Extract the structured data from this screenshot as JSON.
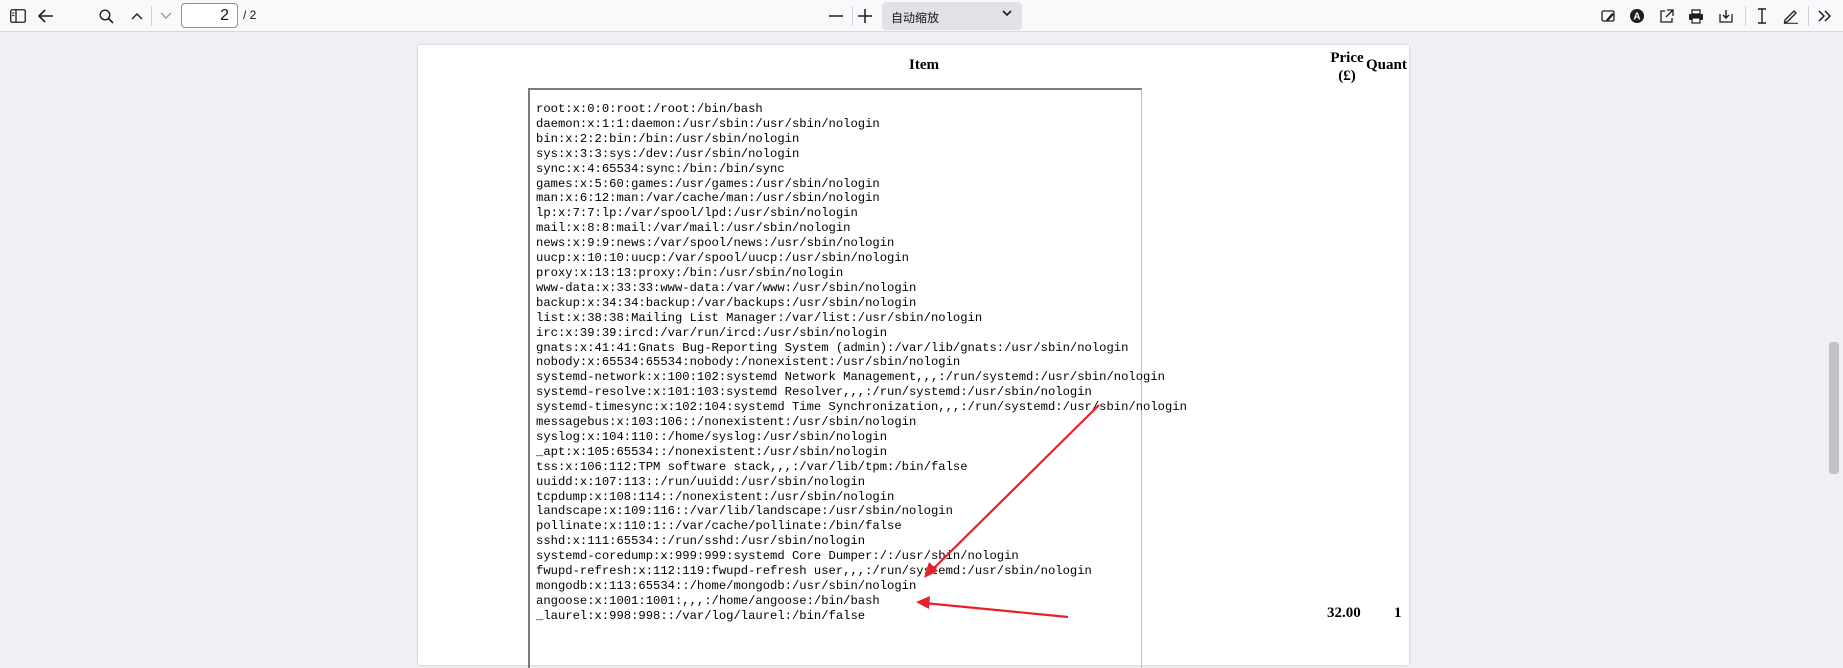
{
  "toolbar": {
    "page_number": "2",
    "page_total": "/ 2",
    "zoom_label": "自动缩放",
    "zoom_out_label": "—",
    "zoom_in_label": "+"
  },
  "document": {
    "header_item": "Item",
    "header_price_line1": "Price",
    "header_price_line2": "(£)",
    "header_quantity": "Quant",
    "passwd_lines": [
      "root:x:0:0:root:/root:/bin/bash",
      "daemon:x:1:1:daemon:/usr/sbin:/usr/sbin/nologin",
      "bin:x:2:2:bin:/bin:/usr/sbin/nologin",
      "sys:x:3:3:sys:/dev:/usr/sbin/nologin",
      "sync:x:4:65534:sync:/bin:/bin/sync",
      "games:x:5:60:games:/usr/games:/usr/sbin/nologin",
      "man:x:6:12:man:/var/cache/man:/usr/sbin/nologin",
      "lp:x:7:7:lp:/var/spool/lpd:/usr/sbin/nologin",
      "mail:x:8:8:mail:/var/mail:/usr/sbin/nologin",
      "news:x:9:9:news:/var/spool/news:/usr/sbin/nologin",
      "uucp:x:10:10:uucp:/var/spool/uucp:/usr/sbin/nologin",
      "proxy:x:13:13:proxy:/bin:/usr/sbin/nologin",
      "www-data:x:33:33:www-data:/var/www:/usr/sbin/nologin",
      "backup:x:34:34:backup:/var/backups:/usr/sbin/nologin",
      "list:x:38:38:Mailing List Manager:/var/list:/usr/sbin/nologin",
      "irc:x:39:39:ircd:/var/run/ircd:/usr/sbin/nologin",
      "gnats:x:41:41:Gnats Bug-Reporting System (admin):/var/lib/gnats:/usr/sbin/nologin",
      "nobody:x:65534:65534:nobody:/nonexistent:/usr/sbin/nologin",
      "systemd-network:x:100:102:systemd Network Management,,,:/run/systemd:/usr/sbin/nologin",
      "systemd-resolve:x:101:103:systemd Resolver,,,:/run/systemd:/usr/sbin/nologin",
      "systemd-timesync:x:102:104:systemd Time Synchronization,,,:/run/systemd:/usr/sbin/nologin",
      "messagebus:x:103:106::/nonexistent:/usr/sbin/nologin",
      "syslog:x:104:110::/home/syslog:/usr/sbin/nologin",
      "_apt:x:105:65534::/nonexistent:/usr/sbin/nologin",
      "tss:x:106:112:TPM software stack,,,:/var/lib/tpm:/bin/false",
      "uuidd:x:107:113::/run/uuidd:/usr/sbin/nologin",
      "tcpdump:x:108:114::/nonexistent:/usr/sbin/nologin",
      "landscape:x:109:116::/var/lib/landscape:/usr/sbin/nologin",
      "pollinate:x:110:1::/var/cache/pollinate:/bin/false",
      "sshd:x:111:65534::/run/sshd:/usr/sbin/nologin",
      "systemd-coredump:x:999:999:systemd Core Dumper:/:/usr/sbin/nologin",
      "fwupd-refresh:x:112:119:fwupd-refresh user,,,:/run/systemd:/usr/sbin/nologin",
      "mongodb:x:113:65534::/home/mongodb:/usr/sbin/nologin",
      "angoose:x:1001:1001:,,,:/home/angoose:/bin/bash",
      "_laurel:x:998:998::/var/log/laurel:/bin/false"
    ],
    "price_value": "32.00",
    "quantity_value": "1"
  },
  "colors": {
    "annotation_arrow": "#e8202a",
    "toolbar_bg": "#f9f9fb",
    "viewer_bg": "#f0f0f4"
  },
  "icons": [
    "sidebar-toggle-icon",
    "back-arrow-icon",
    "search-icon",
    "chevron-up-icon",
    "chevron-down-icon",
    "zoom-out-icon",
    "zoom-in-icon",
    "edit-image-icon",
    "text-annotation-icon",
    "open-external-icon",
    "print-icon",
    "download-icon",
    "text-cursor-icon",
    "draw-icon",
    "more-tools-icon"
  ]
}
